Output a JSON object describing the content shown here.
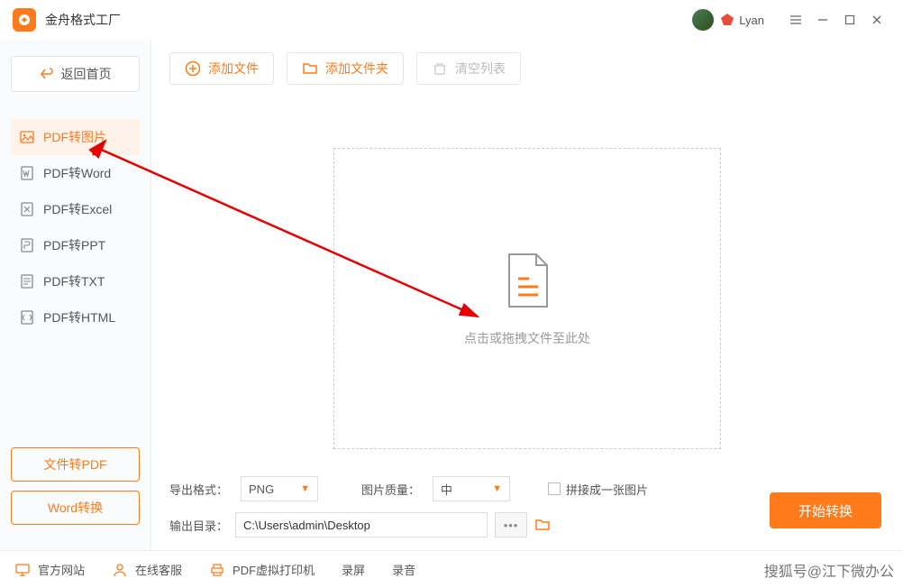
{
  "titlebar": {
    "app_name": "金舟格式工厂",
    "username": "Lyan"
  },
  "sidebar": {
    "back_label": "返回首页",
    "items": [
      {
        "label": "PDF转图片"
      },
      {
        "label": "PDF转Word"
      },
      {
        "label": "PDF转Excel"
      },
      {
        "label": "PDF转PPT"
      },
      {
        "label": "PDF转TXT"
      },
      {
        "label": "PDF转HTML"
      }
    ],
    "file_to_pdf": "文件转PDF",
    "word_convert": "Word转换"
  },
  "toolbar": {
    "add_file": "添加文件",
    "add_folder": "添加文件夹",
    "clear_list": "清空列表"
  },
  "dropzone": {
    "hint": "点击或拖拽文件至此处"
  },
  "options": {
    "export_format_label": "导出格式：",
    "export_format_value": "PNG",
    "image_quality_label": "图片质量：",
    "image_quality_value": "中",
    "merge_label": "拼接成一张图片",
    "output_dir_label": "输出目录：",
    "output_dir_value": "C:\\Users\\admin\\Desktop"
  },
  "actions": {
    "start": "开始转换"
  },
  "footer": {
    "official_site": "官方网站",
    "online_service": "在线客服",
    "virtual_printer": "PDF虚拟打印机",
    "screen_record": "录屏",
    "audio_record": "录音"
  },
  "watermark": "搜狐号@江下微办公"
}
